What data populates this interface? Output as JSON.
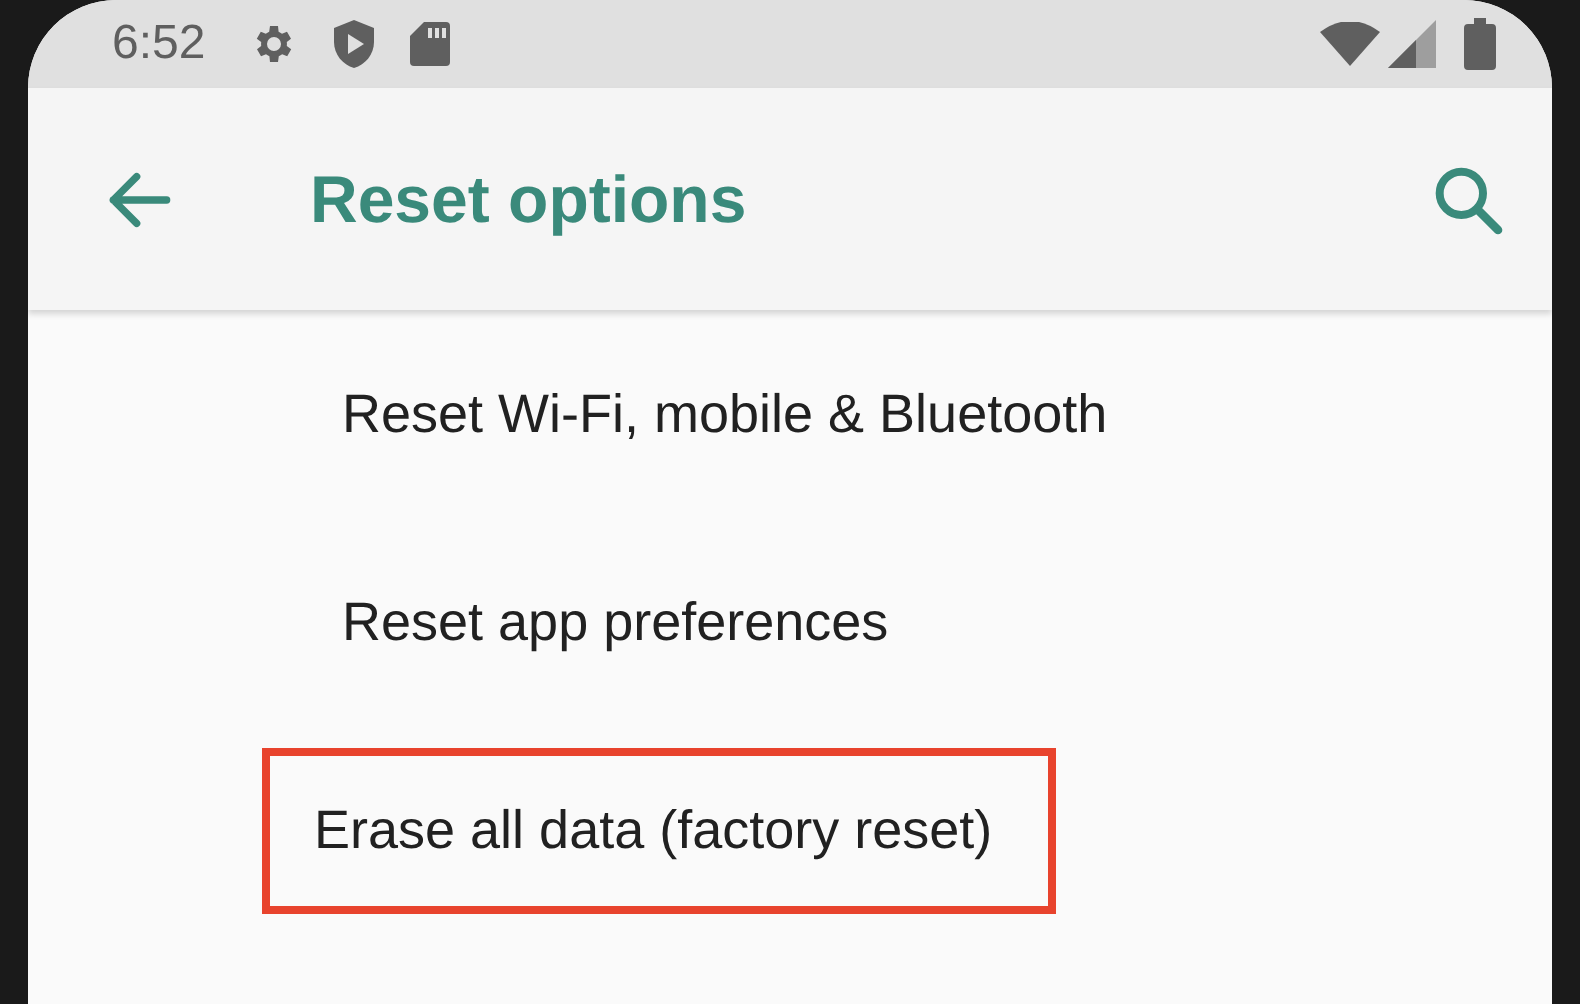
{
  "status_bar": {
    "time": "6:52"
  },
  "app_bar": {
    "title": "Reset options"
  },
  "items": [
    {
      "label": "Reset Wi-Fi, mobile & Bluetooth",
      "highlighted": false
    },
    {
      "label": "Reset app preferences",
      "highlighted": false
    },
    {
      "label": "Erase all data (factory reset)",
      "highlighted": true
    }
  ]
}
